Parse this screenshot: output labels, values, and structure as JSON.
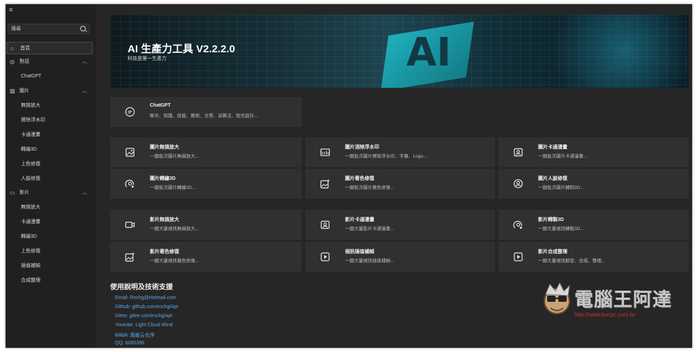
{
  "sidebar": {
    "search_placeholder": "搜尋",
    "home": "首頁",
    "chat": "對話",
    "chat_sub": [
      "ChatGPT"
    ],
    "image": "圖片",
    "image_sub": [
      "無損放大",
      "擦除浮水印",
      "卡通漫畫",
      "轉繪3D",
      "上色修復",
      "人臉修復"
    ],
    "video": "影片",
    "video_sub": [
      "無損放大",
      "卡通漫畫",
      "轉繪3D",
      "上色修復",
      "插值補幀",
      "合成整理"
    ]
  },
  "banner": {
    "title": "AI 生產力工具 V2.2.2.0",
    "subtitle": "科技是第一生產力",
    "graphic_text": "AI"
  },
  "cards": {
    "chat": [
      {
        "title": "ChatGPT",
        "desc": "聊天、知識、技能、藝術、文學、演算法、程式設計...",
        "icon": "chat-bubble-icon"
      }
    ],
    "image": [
      {
        "title": "圖片無損放大",
        "desc": "一鍵批次圖片無損放大...",
        "icon": "image-icon"
      },
      {
        "title": "圖片消除浮水印",
        "desc": "一鍵批次圖片擦除浮水印、字幕、Logo...",
        "icon": "watermark-icon"
      },
      {
        "title": "圖片卡通漫畫",
        "desc": "一鍵批次圖片卡通漫畫...",
        "icon": "portrait-icon"
      },
      {
        "title": "圖片轉繪3D",
        "desc": "一鍵批次圖片轉繪3D...",
        "icon": "3d-icon"
      },
      {
        "title": "圖片著色修復",
        "desc": "一鍵批次圖片著色修復...",
        "icon": "image-sparkle-icon"
      },
      {
        "title": "圖片人臉修復",
        "desc": "一鍵批次圖片轉制3D...",
        "icon": "face-icon"
      }
    ],
    "video": [
      {
        "title": "影片無損放大",
        "desc": "一鍵大量視訊無損放大...",
        "icon": "video-camera-icon"
      },
      {
        "title": "影片卡通漫畫",
        "desc": "一鍵大量影片卡通漫畫...",
        "icon": "portrait-icon"
      },
      {
        "title": "影片轉製3D",
        "desc": "一鍵大量視訊轉製3D...",
        "icon": "3d-icon"
      },
      {
        "title": "影片著色修復",
        "desc": "一鍵大量視訊著色修復...",
        "icon": "image-sparkle-icon"
      },
      {
        "title": "視訊插值補幀",
        "desc": "一鍵大量視訊插值補幀...",
        "icon": "play-icon"
      },
      {
        "title": "影片合成整理",
        "desc": "一鍵大量視訊解密、合成、整理...",
        "icon": "play-icon"
      }
    ]
  },
  "support": {
    "title": "使用說明及技術支援",
    "lines": [
      "Email: Rnchg@Hotmail.com",
      "Github: github.com/rnchg/Apt",
      "Gitee: gitee.com/rnchg/apt",
      "Youtube: Light Cloud Wind",
      "Bilibili: 風輕云也淨",
      "QQ: 6085398"
    ]
  },
  "watermark": {
    "text": "電腦王阿達",
    "url": "http://www.kocpc.com.tw"
  },
  "colors": {
    "background": "#262626",
    "sidebar": "#202020",
    "card": "#303030",
    "link": "#5aa8e8",
    "accent": "#1fc9d6"
  }
}
